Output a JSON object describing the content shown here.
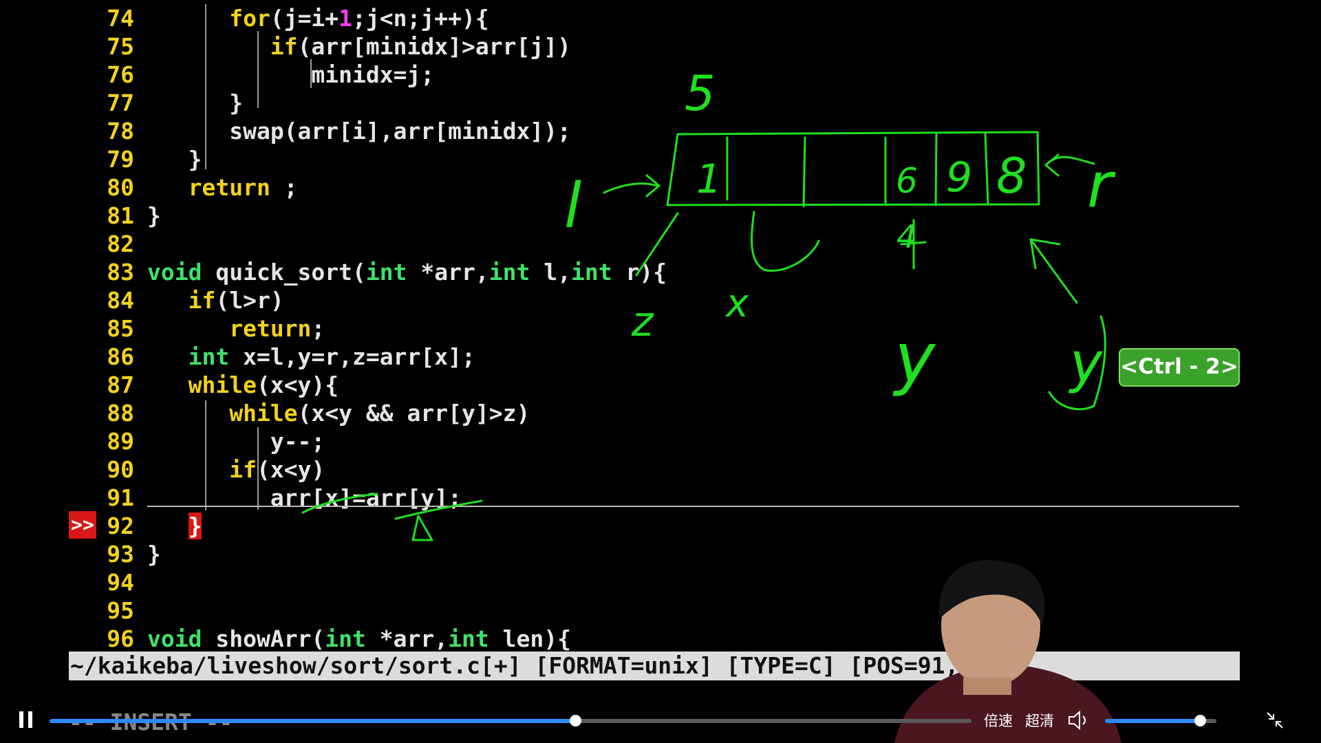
{
  "code_lines": [
    {
      "n": "74",
      "indent": "      ",
      "tokens": [
        [
          "kw",
          "for"
        ],
        [
          "p",
          "(j=i+"
        ],
        [
          "num",
          "1"
        ],
        [
          "p",
          ";j<n;j++){"
        ]
      ]
    },
    {
      "n": "75",
      "indent": "         ",
      "tokens": [
        [
          "kw",
          "if"
        ],
        [
          "p",
          "(arr[minidx]>arr[j])"
        ]
      ]
    },
    {
      "n": "76",
      "indent": "            ",
      "tokens": [
        [
          "p",
          "minidx=j;"
        ]
      ]
    },
    {
      "n": "77",
      "indent": "      ",
      "tokens": [
        [
          "p",
          "}"
        ]
      ]
    },
    {
      "n": "78",
      "indent": "      ",
      "tokens": [
        [
          "p",
          "swap(arr[i],arr[minidx]);"
        ]
      ]
    },
    {
      "n": "79",
      "indent": "   ",
      "tokens": [
        [
          "p",
          "}"
        ]
      ]
    },
    {
      "n": "80",
      "indent": "   ",
      "tokens": [
        [
          "kw",
          "return"
        ],
        [
          "p",
          " ;"
        ]
      ]
    },
    {
      "n": "81",
      "indent": "",
      "tokens": [
        [
          "p",
          "}"
        ]
      ]
    },
    {
      "n": "82",
      "indent": "",
      "tokens": []
    },
    {
      "n": "83",
      "indent": "",
      "tokens": [
        [
          "ty",
          "void"
        ],
        [
          "p",
          " quick_sort("
        ],
        [
          "ty",
          "int"
        ],
        [
          "p",
          " *arr,"
        ],
        [
          "ty",
          "int"
        ],
        [
          "p",
          " l,"
        ],
        [
          "ty",
          "int"
        ],
        [
          "p",
          " r){"
        ]
      ]
    },
    {
      "n": "84",
      "indent": "   ",
      "tokens": [
        [
          "kw",
          "if"
        ],
        [
          "p",
          "(l>r)"
        ]
      ]
    },
    {
      "n": "85",
      "indent": "      ",
      "tokens": [
        [
          "kw",
          "return"
        ],
        [
          "p",
          ";"
        ]
      ]
    },
    {
      "n": "86",
      "indent": "   ",
      "tokens": [
        [
          "ty",
          "int"
        ],
        [
          "p",
          " x=l,y=r,z=arr[x];"
        ]
      ]
    },
    {
      "n": "87",
      "indent": "   ",
      "tokens": [
        [
          "kw",
          "while"
        ],
        [
          "p",
          "(x<y){"
        ]
      ]
    },
    {
      "n": "88",
      "indent": "      ",
      "tokens": [
        [
          "kw",
          "while"
        ],
        [
          "p",
          "(x<y && arr[y]>z)"
        ]
      ]
    },
    {
      "n": "89",
      "indent": "         ",
      "tokens": [
        [
          "p",
          "y--;"
        ]
      ]
    },
    {
      "n": "90",
      "indent": "      ",
      "tokens": [
        [
          "kw",
          "if"
        ],
        [
          "p",
          "(x<y)"
        ]
      ]
    },
    {
      "n": "91",
      "indent": "         ",
      "tokens": [
        [
          "p",
          "arr[x]=arr[y];"
        ]
      ]
    },
    {
      "n": "92",
      "indent": "   ",
      "tokens": [
        [
          "err",
          "}"
        ]
      ]
    },
    {
      "n": "93",
      "indent": "",
      "tokens": [
        [
          "p",
          "}"
        ]
      ]
    },
    {
      "n": "94",
      "indent": "",
      "tokens": []
    },
    {
      "n": "95",
      "indent": "",
      "tokens": []
    },
    {
      "n": "96",
      "indent": "",
      "tokens": [
        [
          "ty",
          "void"
        ],
        [
          "p",
          " showArr("
        ],
        [
          "ty",
          "int"
        ],
        [
          "p",
          " *arr,"
        ],
        [
          "ty",
          "int"
        ],
        [
          "p",
          " len){"
        ]
      ]
    }
  ],
  "sign_marker": ">>",
  "status_line": "~/kaikeba/liveshow/sort/sort.c[+] [FORMAT=unix] [TYPE=C] [POS=91,27",
  "mode_text": "-- INSERT --",
  "shortcut_badge": "<Ctrl - 2>",
  "annotations": {
    "top_number": "5",
    "cells": [
      "1",
      "",
      "",
      "6",
      "9",
      "8"
    ],
    "labels": [
      "l",
      "r",
      "x",
      "y",
      "z",
      "y"
    ],
    "number_4": "4"
  },
  "player": {
    "progress": 0.57,
    "speed_label": "倍速",
    "quality_label": "超清",
    "volume": 0.85
  },
  "colors": {
    "keyword": "#f2d21b",
    "type": "#3ee26a",
    "number": "#ff3df2",
    "ink": "#1fe01f",
    "accent": "#2a8cff"
  },
  "icons": {
    "play": "pause-icon",
    "volume": "volume-icon",
    "exit_fullscreen": "exit-fullscreen-icon"
  }
}
